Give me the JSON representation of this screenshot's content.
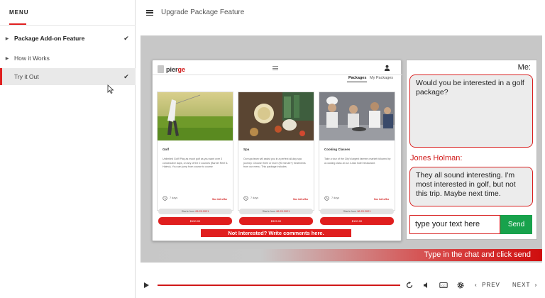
{
  "sidebar": {
    "title": "MENU",
    "items": [
      {
        "label": "Package Add-on Feature",
        "completed": true,
        "bold": true,
        "active": false
      },
      {
        "label": "How it Works",
        "completed": false,
        "bold": false,
        "active": false
      },
      {
        "label": "Try it Out",
        "completed": true,
        "bold": false,
        "active": true
      }
    ]
  },
  "header": {
    "title": "Upgrade Package Feature"
  },
  "app": {
    "logo": {
      "prefix": "pier",
      "accent": "ge"
    },
    "tabs": [
      "Packages",
      "My Packages"
    ],
    "cards": [
      {
        "name": "Golf",
        "description": "Unlimited Golf! Play as much golf as you want over 3 consecutive days, on any of the 2 courses (Barnet Reef & Halmo). You can jump from course to course",
        "days": "7 days",
        "full_offer": "See full offer",
        "starts_prefix": "Starts from",
        "starts_date": "06.20.2021",
        "price": "$150.00"
      },
      {
        "name": "Spa",
        "description": "Our spa team will assist you in a perfect all-day spa journey. Choose three or more (90 minute+) treatments from our menu. This package includes",
        "days": "7 days",
        "full_offer": "See full offer",
        "starts_prefix": "Starts from",
        "starts_date": "06.20.2021",
        "price": "$325.00"
      },
      {
        "name": "Cooking Classes",
        "description": "Take a tour of the City's largest farmers market followed by a cooking class at our 4-star hotel restaurant.",
        "days": "7 days",
        "full_offer": "See full offer",
        "starts_prefix": "Starts from",
        "starts_date": "06.20.2021",
        "price": "$190.00"
      }
    ],
    "not_interested_label": "Not Interested? Write comments here."
  },
  "chat": {
    "me_label": "Me:",
    "me_message": "Would you be interested in a golf package?",
    "other_label": "Jones Holman:",
    "other_message": "They all sound interesting. I'm most interested in golf, but not this trip. Maybe next time.",
    "input_value": "type your text here",
    "send_label": "Send"
  },
  "instruction": "Type in the chat and click send",
  "player": {
    "prev_label": "PREV",
    "next_label": "NEXT",
    "progress": 1.0,
    "icons": [
      "play-icon",
      "replay-icon",
      "volume-icon",
      "captions-icon",
      "settings-icon"
    ]
  },
  "colors": {
    "accent": "#e01e1e",
    "send": "#18a24c",
    "slide_bg": "#c7c7c7"
  }
}
